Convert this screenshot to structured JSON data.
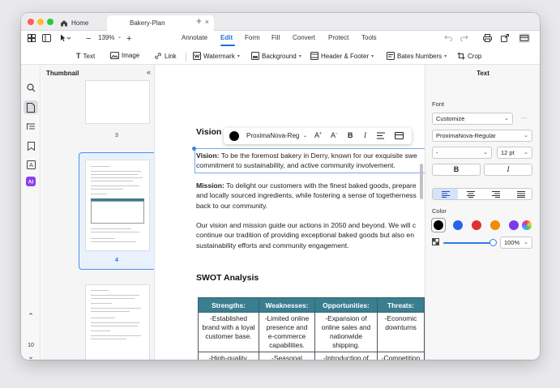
{
  "titlebar": {
    "tabs": [
      {
        "label": "Home"
      },
      {
        "label": "Bakery-Plan"
      }
    ],
    "close_glyph": "×",
    "add_glyph": "+"
  },
  "toolbar": {
    "zoom": "139%",
    "menu": [
      "Annotate",
      "Edit",
      "Form",
      "Fill",
      "Convert",
      "Protect",
      "Tools"
    ],
    "active_menu": "Edit",
    "accent_color": "#1e6fd9"
  },
  "edit_toolbar": {
    "items": [
      "Text",
      "Image",
      "Link",
      "Watermark",
      "Background",
      "Header & Footer",
      "Bates Numbers",
      "Crop"
    ]
  },
  "sidebar": {
    "title": "Thumbnail",
    "pages": [
      {
        "number": "3"
      },
      {
        "number": "4",
        "selected": true
      }
    ],
    "current_page": "4",
    "total_pages": "10"
  },
  "float_toolbar": {
    "font_name": "ProximaNova-Reg",
    "color": "#000000"
  },
  "document": {
    "heading_vision": "Vision",
    "vision_label": "Vision:",
    "vision_line1": " To be the foremost bakery in Derry, known for our exquisite swe",
    "vision_line2": "commitment to sustainability, and active community involvement.",
    "mission_label": "Mission:",
    "mission_line1": " To delight our customers with the finest baked goods, prepare",
    "mission_line2": "and locally sourced ingredients, while fostering a sense of togetherness",
    "mission_line3": "back to our community.",
    "para_line1": "Our vision and mission guide our actions in 2050 and beyond. We will c",
    "para_line2": "continue our tradition of providing exceptional baked goods but also en",
    "para_line3": "sustainability efforts and community engagement.",
    "swot_heading": "SWOT Analysis",
    "swot_headers": [
      "Strengths:",
      "Weaknesses:",
      "Opportunities:",
      "Threats:"
    ],
    "swot_rows": [
      [
        "-Established brand with a loyal customer base.",
        "-Limited online presence and e-commerce capabilities.",
        "-Expansion of online sales and nationwide shipping.",
        "-Economic downturns"
      ],
      [
        "-High-quality, locally sourced ingredients.",
        "-Seasonal fluctuations",
        "-Introduction of gluten-free and vegan",
        "-Competition"
      ]
    ]
  },
  "right_panel": {
    "title": "Text",
    "font_label": "Font",
    "style_select": "Customize",
    "font_family": "ProximaNova-Regular",
    "font_weight": "-",
    "font_size": "12 pt",
    "bold_glyph": "B",
    "italic_glyph": "I",
    "color_label": "Color",
    "colors": [
      "#000000",
      "#2563eb",
      "#e03131",
      "#f08c00",
      "#7c3aed"
    ],
    "opacity": "100%",
    "opacity_value": 1.0,
    "more_glyph": "···"
  }
}
